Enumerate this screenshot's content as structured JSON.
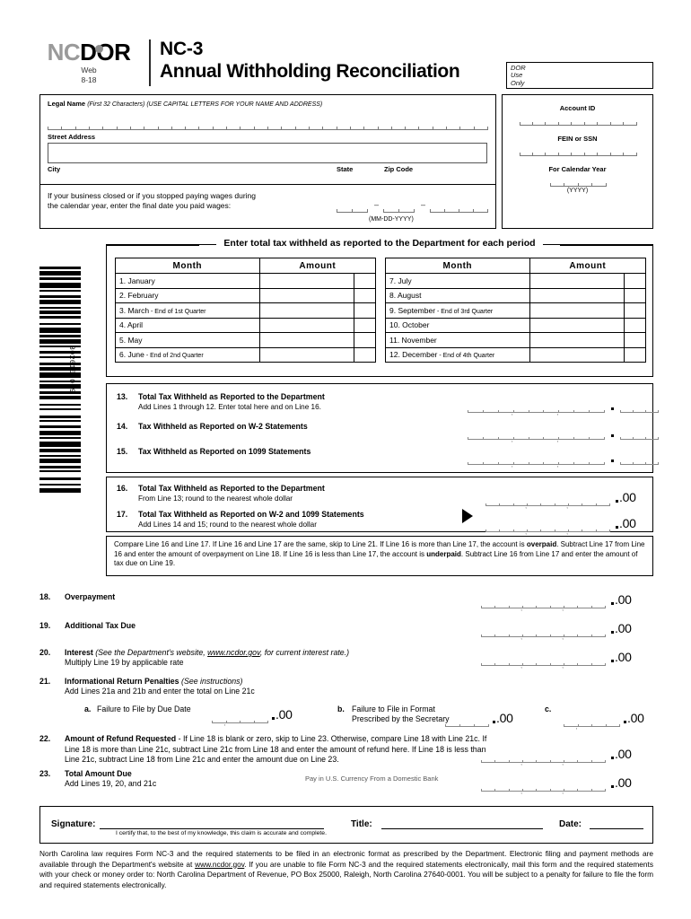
{
  "header": {
    "logo_nc": "NC",
    "logo_dor": "DOR",
    "logo_sub_line1": "Web",
    "logo_sub_line2": "8-18",
    "form_number": "NC-3",
    "form_title": "Annual Withholding Reconciliation",
    "dor_use_line1": "DOR",
    "dor_use_line2": "Use",
    "dor_use_line3": "Only"
  },
  "taxpayer": {
    "legal_name_label": "Legal Name",
    "legal_name_hint": "(First 32 Characters) (USE CAPITAL LETTERS FOR YOUR NAME AND ADDRESS)",
    "street_label": "Street Address",
    "city_label": "City",
    "state_label": "State",
    "zip_label": "Zip Code",
    "closed_text_line1": "If your business closed or if you stopped paying wages during",
    "closed_text_line2": "the calendar year, enter the final date you paid wages:",
    "date_format_hint": "(MM-DD-YYYY)",
    "dash": "–"
  },
  "identifiers": {
    "account_id_label": "Account ID",
    "fein_ssn_label": "FEIN or SSN",
    "calendar_year_label": "For Calendar Year",
    "year_format_hint": "(YYYY)"
  },
  "barcode": {
    "number": "3020106009"
  },
  "period_section": {
    "title": "Enter total tax withheld as reported to the Department for each period",
    "col_month": "Month",
    "col_amount": "Amount",
    "rows_left": [
      {
        "num": "1.",
        "month": "January",
        "qualifier": ""
      },
      {
        "num": "2.",
        "month": "February",
        "qualifier": ""
      },
      {
        "num": "3.",
        "month": "March",
        "qualifier": " - End of 1st Quarter"
      },
      {
        "num": "4.",
        "month": "April",
        "qualifier": ""
      },
      {
        "num": "5.",
        "month": "May",
        "qualifier": ""
      },
      {
        "num": "6.",
        "month": "June",
        "qualifier": " - End of 2nd Quarter"
      }
    ],
    "rows_right": [
      {
        "num": "7.",
        "month": "July",
        "qualifier": ""
      },
      {
        "num": "8.",
        "month": "August",
        "qualifier": ""
      },
      {
        "num": "9.",
        "month": "September",
        "qualifier": " - End of 3rd Quarter"
      },
      {
        "num": "10.",
        "month": "October",
        "qualifier": ""
      },
      {
        "num": "11.",
        "month": "November",
        "qualifier": ""
      },
      {
        "num": "12.",
        "month": "December",
        "qualifier": " - End of 4th Quarter"
      }
    ]
  },
  "lines": {
    "l13_num": "13.",
    "l13_title": "Total Tax Withheld as Reported to the Department",
    "l13_sub": "Add Lines 1 through 12.  Enter total here and on Line 16.",
    "l14_num": "14.",
    "l14_title": "Tax Withheld as Reported on W-2 Statements",
    "l15_num": "15.",
    "l15_title": "Tax Withheld as Reported on 1099 Statements",
    "l16_num": "16.",
    "l16_title": "Total Tax Withheld as Reported to the Department",
    "l16_sub": "From Line 13; round to the nearest whole dollar",
    "l17_num": "17.",
    "l17_title": "Total Tax Withheld as Reported on  W-2 and 1099 Statements",
    "l17_sub": "Add Lines 14 and 15; round to the nearest whole dollar",
    "compare_note": "Compare Line 16 and Line 17.  If Line 16 and Line 17 are the same, skip to Line 21.  If Line 16 is more than Line 17, the account is <b>overpaid</b>.  Subtract Line 17 from Line 16 and enter the amount of overpayment on Line 18.  If Line 16 is less than Line 17, the account is <b>underpaid</b>.  Subtract Line 16 from Line 17 and enter the amount of tax due on Line 19.",
    "l18_num": "18.",
    "l18_title": "Overpayment",
    "l19_num": "19.",
    "l19_title": "Additional Tax Due",
    "l20_num": "20.",
    "l20_title": "Interest",
    "l20_hint_pre": "(See the Department's website, ",
    "l20_hint_link": "www.ncdor.gov",
    "l20_hint_post": ", for current interest rate.)",
    "l20_sub": "Multiply Line 19 by applicable rate",
    "l21_num": "21.",
    "l21_title": "Informational Return Penalties",
    "l21_hint": "(See instructions)",
    "l21_sub": "Add Lines 21a and 21b and enter the total on Line 21c",
    "l21a_num": "a.",
    "l21a_title": "Failure to File by Due Date",
    "l21b_num": "b.",
    "l21b_title_line1": "Failure to File in Format",
    "l21b_title_line2": "Prescribed by the Secretary",
    "l21c_num": "c.",
    "l22_num": "22.",
    "l22_title": "Amount of Refund Requested",
    "l22_body": " - If Line 18 is blank or zero, skip to Line 23. Otherwise, compare Line 18 with Line 21c. If Line 18 is more than Line 21c, subtract Line 21c from Line 18 and enter the amount of refund here. If Line 18 is less than Line 21c, subtract Line 18 from Line 21c and enter the amount due on Line 23.",
    "l23_num": "23.",
    "l23_title": "Total Amount Due",
    "l23_sub": "Add Lines 19, 20, and 21c",
    "l23_note": "Pay in U.S. Currency From a Domestic Bank",
    "cents_suffix": ".00"
  },
  "signature": {
    "signature_label": "Signature:",
    "title_label": "Title:",
    "date_label": "Date:",
    "certify_text": "I certify that, to the best of my knowledge, this claim is accurate and complete."
  },
  "footer": {
    "text_part1": "North Carolina law requires Form NC-3 and the required statements to be filed in an electronic format as prescribed by the Department.  Electronic filing and payment methods are available through the Department's website at ",
    "link": "www.ncdor.gov",
    "text_part2": ".  If you are unable to file Form NC-3 and the required statements electronically, mail this form and the required statements with your check or money order to: North Carolina Department of Revenue, PO Box 25000, Raleigh, North Carolina 27640-0001.  You will be subject to a penalty for failure to file the form and required statements electronically."
  },
  "colors": {
    "logo_gray": "#9a9a9a",
    "rule_gray": "#888888",
    "ink": "#000000"
  }
}
